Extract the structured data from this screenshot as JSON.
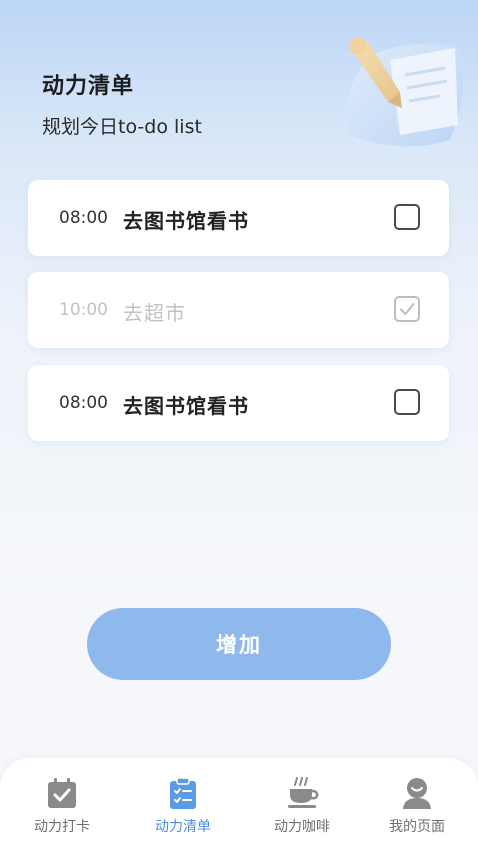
{
  "header": {
    "title": "动力清单",
    "subtitle": "规划今日to-do list"
  },
  "todos": [
    {
      "time": "08:00",
      "task": "去图书馆看书",
      "checked": false
    },
    {
      "time": "10:00",
      "task": "去超市",
      "checked": true
    },
    {
      "time": "08:00",
      "task": "去图书馆看书",
      "checked": false
    }
  ],
  "add_button": {
    "label": "增加"
  },
  "tabbar": {
    "items": [
      {
        "label": "动力打卡",
        "icon": "calendar-check-icon",
        "active": false
      },
      {
        "label": "动力清单",
        "icon": "clipboard-list-icon",
        "active": true
      },
      {
        "label": "动力咖啡",
        "icon": "coffee-cup-icon",
        "active": false
      },
      {
        "label": "我的页面",
        "icon": "user-profile-icon",
        "active": false
      }
    ]
  },
  "colors": {
    "accent": "#8fb8ec",
    "active_tab": "#4d8ee0",
    "tab_icon_gray": "#8a8a8a",
    "done_text": "#c2c2c2"
  }
}
